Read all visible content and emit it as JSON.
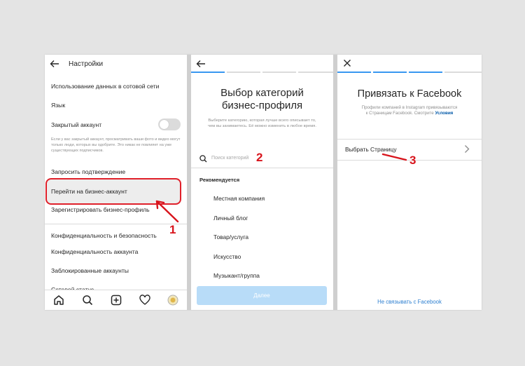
{
  "panel1": {
    "header_title": "Настройки",
    "items": {
      "cellular": "Использование данных в сотовой сети",
      "language": "Язык",
      "private": "Закрытый аккаунт",
      "private_desc": "Если у вас закрытый аккаунт, просматривать ваши фото и видео могут только люди, которых вы одобрите. Это никак не повлияет на уже существующих подписчиков.",
      "verify": "Запросить подтверждение",
      "business": "Перейти на бизнес-аккаунт",
      "register": "Зарегистрировать бизнес-профиль",
      "privacy_security": "Конфиденциальность и безопасность",
      "account_privacy": "Конфиденциальность аккаунта",
      "blocked": "Заблокированные аккаунты",
      "network_status": "Сетевой статус"
    },
    "annotation": "1"
  },
  "panel2": {
    "title": "Выбор категорий бизнес-профиля",
    "description": "Выберите категорию, которая лучше всего описывает то, чем вы занимаетесь. Её можно изменить в любое время.",
    "search_placeholder": "Поиск категорий",
    "recommended_label": "Рекомендуется",
    "categories": [
      "Местная компания",
      "Личный блог",
      "Товар/услуга",
      "Искусство",
      "Музыкант/группа"
    ],
    "done_label": "Далее",
    "annotation": "2"
  },
  "panel3": {
    "title": "Привязать к Facebook",
    "description": "Профили компаний в Instagram привязываются к Страницам Facebook. Смотрите",
    "terms_link": "Условия",
    "choose_page": "Выбрать Страницу",
    "no_link": "Не связывать с Facebook",
    "annotation": "3"
  },
  "colors": {
    "annotation_red": "#d8141c",
    "link_blue": "#2d7fd0",
    "disabled_button": "#b8dcf8"
  }
}
